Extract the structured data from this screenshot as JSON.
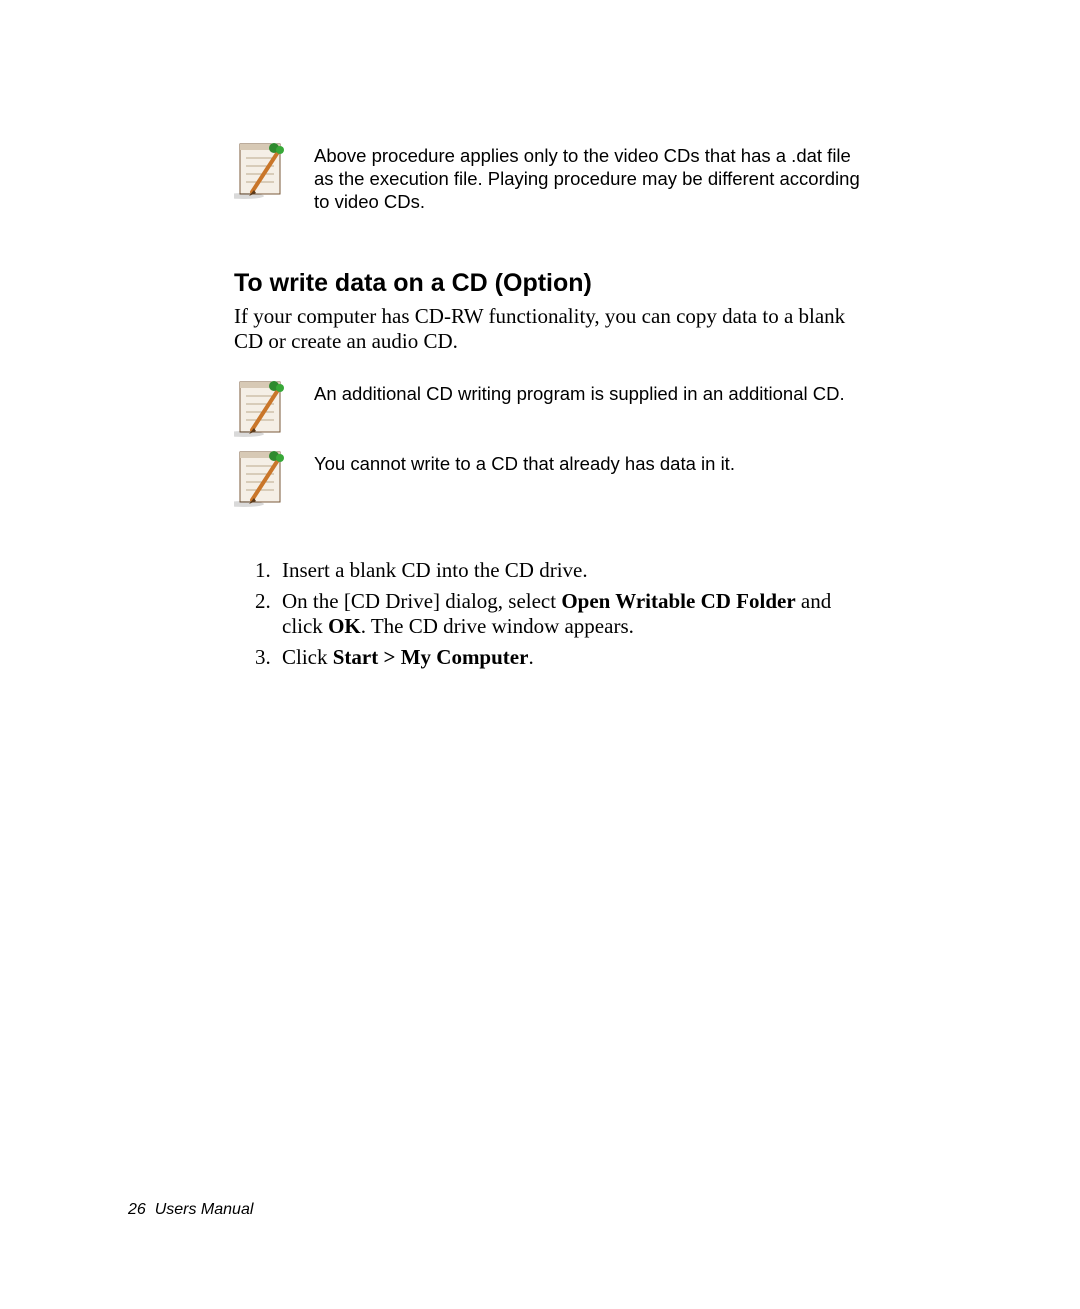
{
  "notes": {
    "top": "Above procedure applies only to the video CDs that has a .dat file as the execution file. Playing procedure may be different according to video CDs.",
    "program": "An additional CD writing program is supplied in an additional CD.",
    "nowrite": "You cannot write to a CD that already has data in it."
  },
  "section": {
    "heading": "To write data on a CD (Option)",
    "intro": "If your computer has CD-RW functionality, you can copy data to a blank CD or create an audio CD."
  },
  "steps": {
    "s1": "Insert a blank CD into the CD drive.",
    "s2a": "On the [CD Drive] dialog, select ",
    "s2b": "Open Writable CD Folder",
    "s2c": " and click ",
    "s2d": "OK",
    "s2e": ". The CD drive window appears.",
    "s3a": "Click ",
    "s3b": "Start > My Computer",
    "s3c": "."
  },
  "footer": {
    "page": "26",
    "title": "Users Manual"
  }
}
